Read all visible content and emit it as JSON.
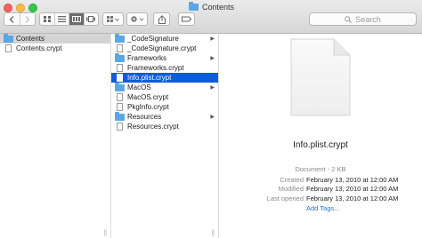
{
  "window": {
    "title": "Contents"
  },
  "toolbar": {
    "back_icon": "chevron-left-icon",
    "forward_icon": "chevron-right-icon",
    "view_modes": [
      "icon-view",
      "list-view",
      "column-view",
      "cover-flow-view"
    ],
    "active_view": "column-view",
    "search_placeholder": "Search"
  },
  "pane1": {
    "items": [
      {
        "label": "Contents",
        "type": "folder"
      },
      {
        "label": "Contents.crypt",
        "type": "file"
      }
    ]
  },
  "pane2": {
    "items": [
      {
        "label": "_CodeSignature",
        "type": "folder"
      },
      {
        "label": "_CodeSignature.crypt",
        "type": "file"
      },
      {
        "label": "Frameworks",
        "type": "folder"
      },
      {
        "label": "Frameworks.crypt",
        "type": "file"
      },
      {
        "label": "Info.plist.crypt",
        "type": "file"
      },
      {
        "label": "MacOS",
        "type": "folder"
      },
      {
        "label": "MacOS.crypt",
        "type": "file"
      },
      {
        "label": "PkgInfo.crypt",
        "type": "file"
      },
      {
        "label": "Resources",
        "type": "folder"
      },
      {
        "label": "Resources.crypt",
        "type": "file"
      }
    ]
  },
  "preview": {
    "filename": "Info.plist.crypt",
    "kind": "Document - 2 KB",
    "created_label": "Created",
    "created": "February 13, 2010 at 12:00 AM",
    "modified_label": "Modified",
    "modified": "February 13, 2010 at 12:00 AM",
    "last_opened_label": "Last opened",
    "last_opened": "February 13, 2010 at 12:00 AM",
    "add_tags": "Add Tags..."
  },
  "colors": {
    "selection_blue": "#0f5cd9",
    "folder_blue": "#5aa7e6",
    "link_blue": "#2a6fd6"
  }
}
